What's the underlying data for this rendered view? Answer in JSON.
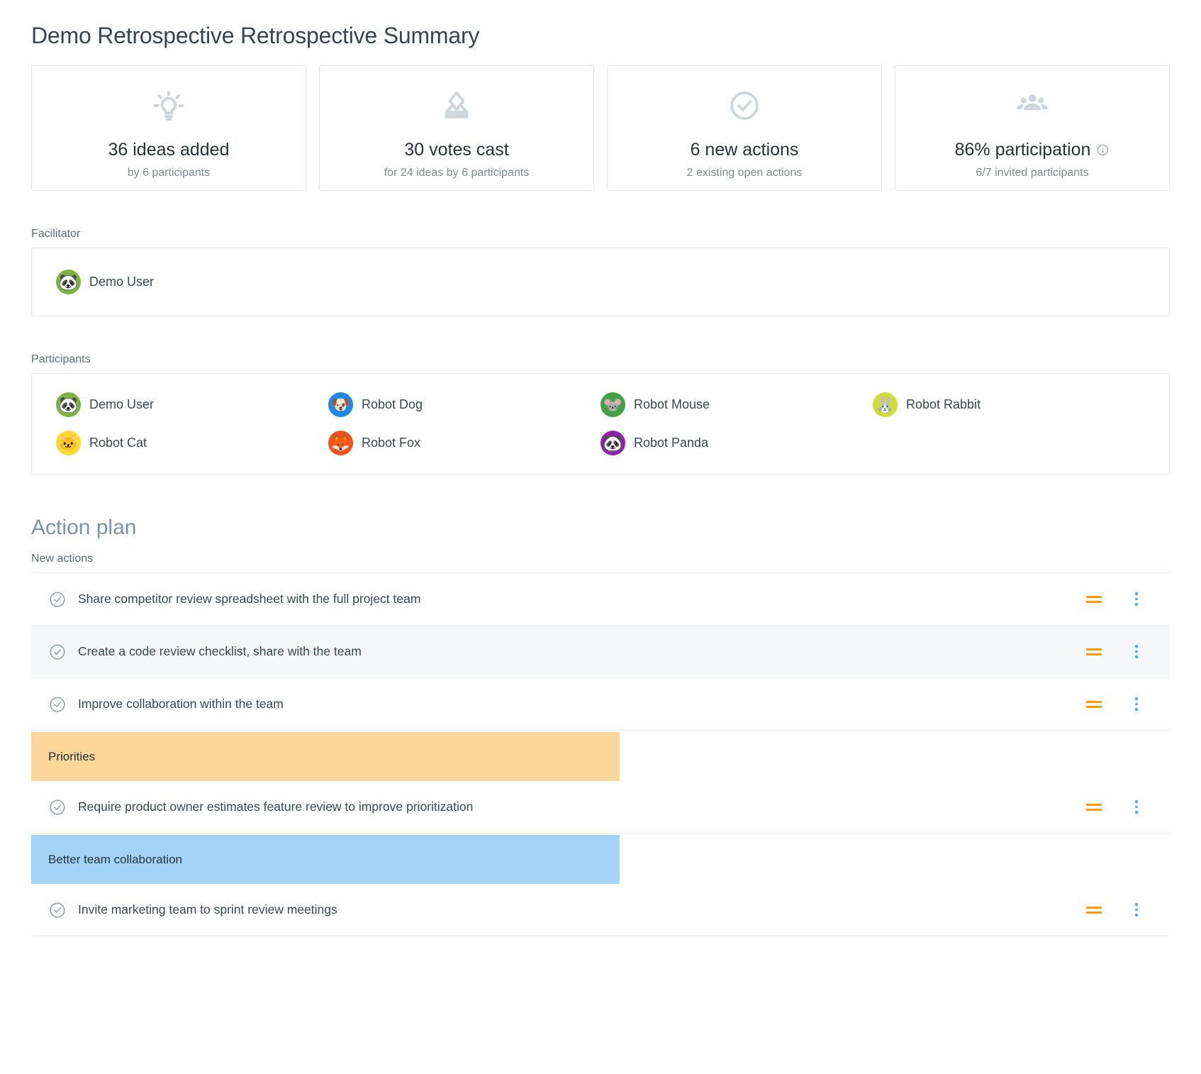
{
  "header": {
    "title": "Demo Retrospective Retrospective Summary"
  },
  "stats": [
    {
      "icon": "lightbulb-icon",
      "main": "36 ideas added",
      "sub": "by 6 participants",
      "has_info": false
    },
    {
      "icon": "vote-icon",
      "main": "30 votes cast",
      "sub": "for 24 ideas by 6 participants",
      "has_info": false
    },
    {
      "icon": "check-circle-icon",
      "main": "6 new actions",
      "sub": "2 existing open actions",
      "has_info": false
    },
    {
      "icon": "people-group-icon",
      "main": "86% participation",
      "sub": "6/7 invited participants",
      "has_info": true
    }
  ],
  "facilitator": {
    "label": "Facilitator",
    "person": {
      "name": "Demo User",
      "emoji": "🐼",
      "color": "#7cb342"
    }
  },
  "participants": {
    "label": "Participants",
    "people": [
      {
        "name": "Demo User",
        "emoji": "🐼",
        "color": "#7cb342"
      },
      {
        "name": "Robot Dog",
        "emoji": "🐶",
        "color": "#1e88e5"
      },
      {
        "name": "Robot Mouse",
        "emoji": "🐭",
        "color": "#43a047"
      },
      {
        "name": "Robot Rabbit",
        "emoji": "🐰",
        "color": "#cddc39"
      },
      {
        "name": "Robot Cat",
        "emoji": "🐱",
        "color": "#fdd835"
      },
      {
        "name": "Robot Fox",
        "emoji": "🦊",
        "color": "#f4511e"
      },
      {
        "name": "Robot Panda",
        "emoji": "🐼",
        "color": "#8e24aa"
      }
    ]
  },
  "action_plan": {
    "title": "Action plan",
    "new_actions_label": "New actions",
    "priority_icon_color": "#ff9800",
    "menu_icon_color": "#42a5f5",
    "items": [
      {
        "kind": "action",
        "text": "Share competitor review spreadsheet with the full project team",
        "alt": false
      },
      {
        "kind": "action",
        "text": "Create a code review checklist, share with the team",
        "alt": true
      },
      {
        "kind": "action",
        "text": "Improve collaboration within the team",
        "alt": false
      },
      {
        "kind": "tag",
        "text": "Priorities",
        "color": "orange"
      },
      {
        "kind": "action",
        "text": "Require product owner estimates feature review to improve prioritization",
        "alt": false
      },
      {
        "kind": "tag",
        "text": "Better team collaboration",
        "color": "blue"
      },
      {
        "kind": "action",
        "text": "Invite marketing team to sprint review meetings",
        "alt": false
      }
    ]
  }
}
